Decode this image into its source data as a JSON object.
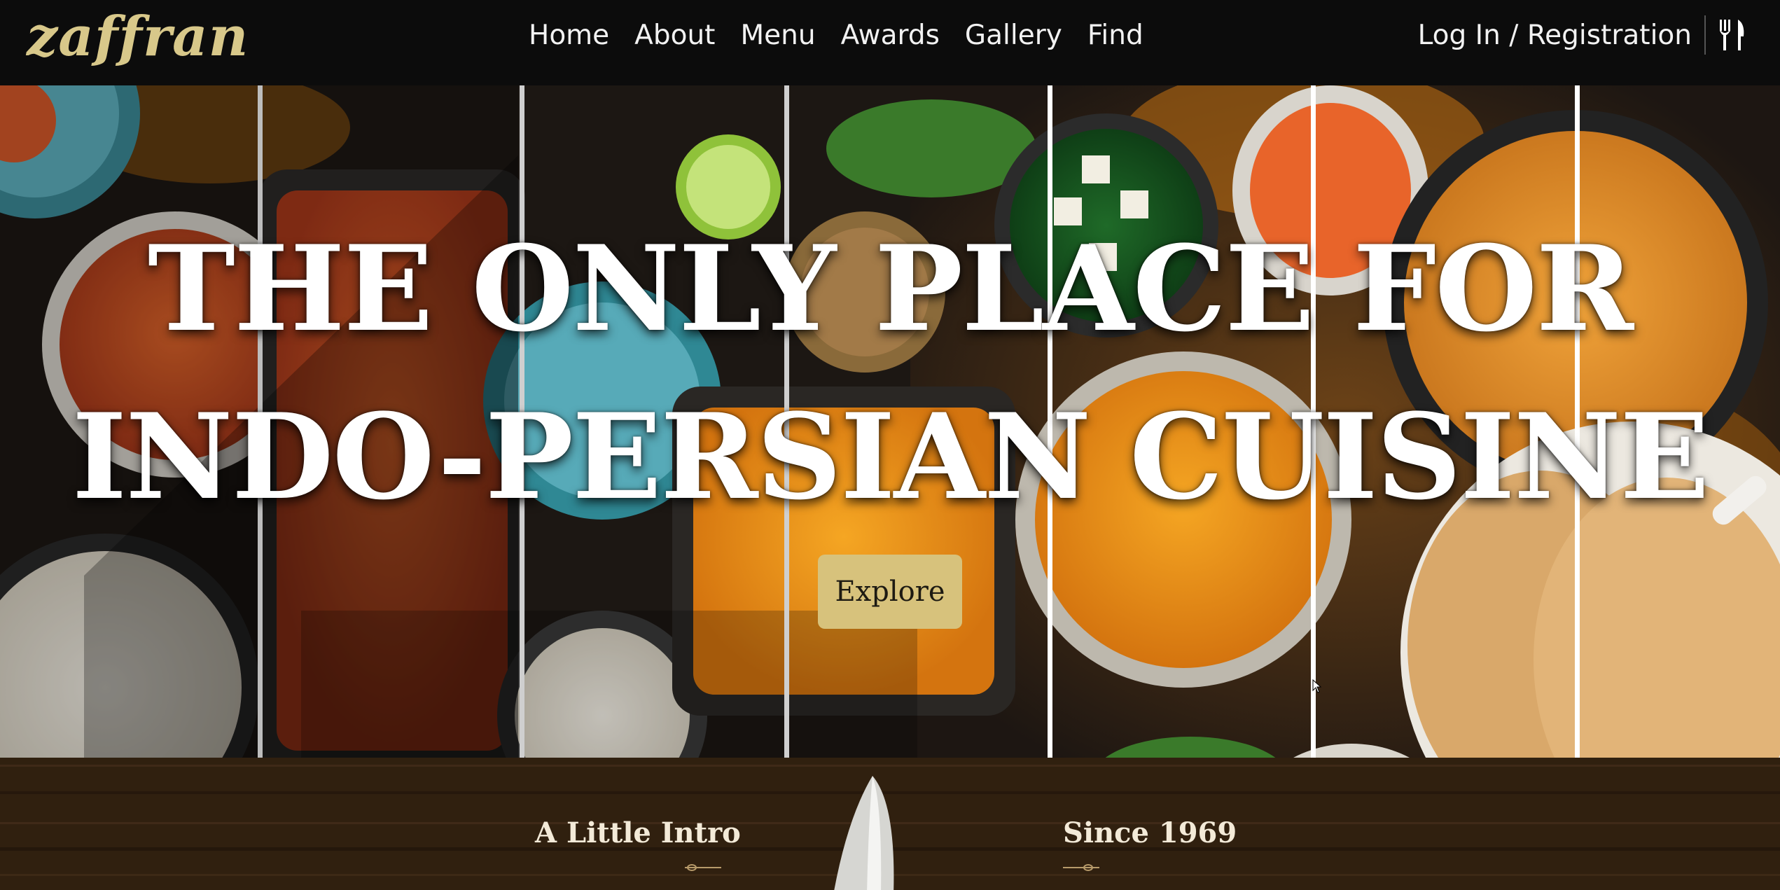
{
  "brand": {
    "logo_text": "zaffran",
    "logo_color": "#d8c88a"
  },
  "nav": {
    "links": [
      "Home",
      "About",
      "Menu",
      "Awards",
      "Gallery",
      "Find"
    ],
    "login_label": "Log In / Registration",
    "icon": "cutlery-icon"
  },
  "hero": {
    "title_line1": "THE ONLY PLACE FOR",
    "title_line2": "INDO-PERSIAN CUISINE",
    "cta_label": "Explore",
    "cta_color": "#d7c27c"
  },
  "intro": {
    "left_heading": "A Little Intro",
    "right_heading": "Since 1969"
  }
}
